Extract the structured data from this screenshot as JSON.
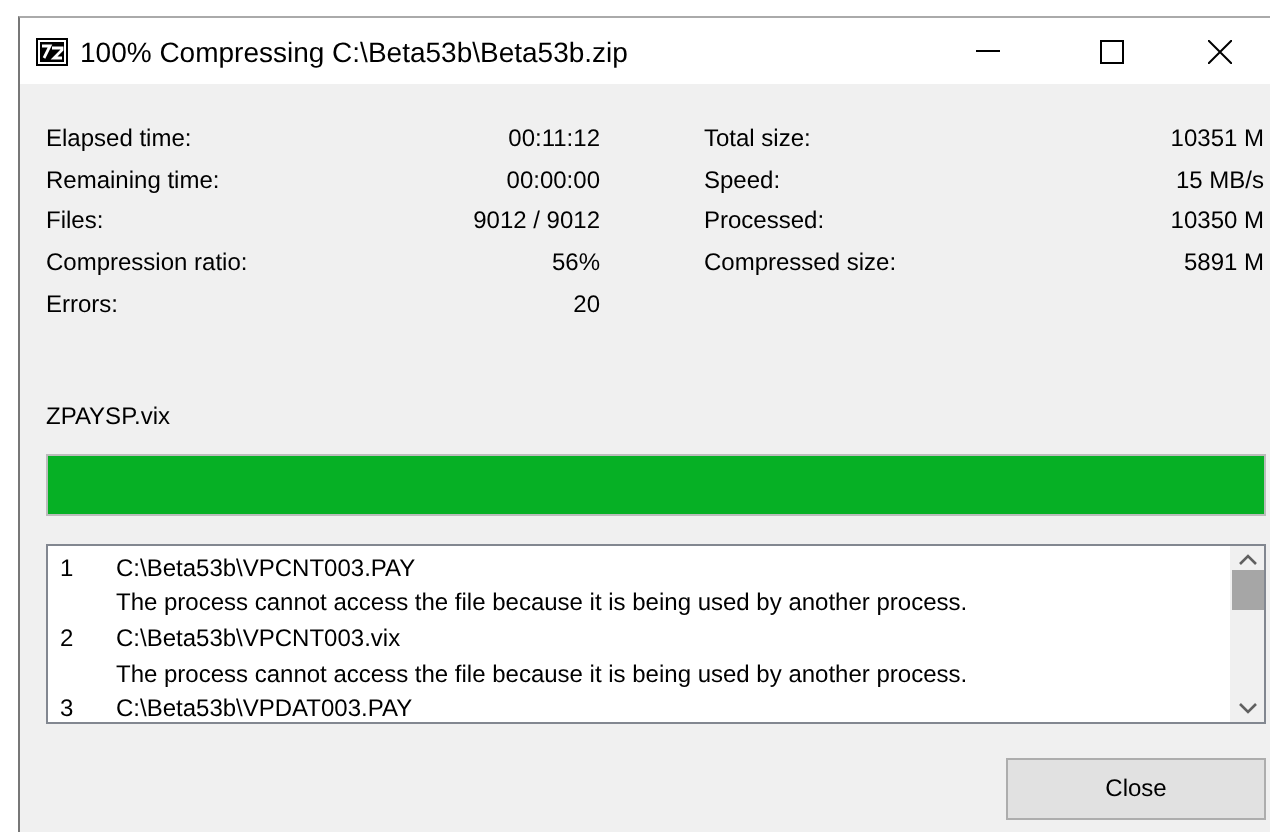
{
  "window": {
    "title": "100% Compressing C:\\Beta53b\\Beta53b.zip"
  },
  "stats_left": [
    {
      "label": "Elapsed time:",
      "value": "00:11:12"
    },
    {
      "label": "Remaining time:",
      "value": "00:00:00"
    },
    {
      "label": "Files:",
      "value": "9012 / 9012"
    },
    {
      "label": "Compression ratio:",
      "value": "56%"
    },
    {
      "label": "Errors:",
      "value": "20"
    }
  ],
  "stats_right": [
    {
      "label": "Total size:",
      "value": "10351 M"
    },
    {
      "label": "Speed:",
      "value": "15 MB/s"
    },
    {
      "label": "Processed:",
      "value": "10350 M"
    },
    {
      "label": "Compressed size:",
      "value": "5891 M"
    }
  ],
  "current_file": "ZPAYSP.vix",
  "progress": {
    "level": 1
  },
  "log": [
    {
      "number": "1",
      "path": "C:\\Beta53b\\VPCNT003.PAY",
      "message": "The process cannot access the file because it is being used by another process."
    },
    {
      "number": "2",
      "path": "C:\\Beta53b\\VPCNT003.vix",
      "message": "The process cannot access the file because it is being used by another process."
    },
    {
      "number": "3",
      "path": "C:\\Beta53b\\VPDAT003.PAY"
    }
  ],
  "buttons": [
    {
      "label": "Close"
    }
  ]
}
